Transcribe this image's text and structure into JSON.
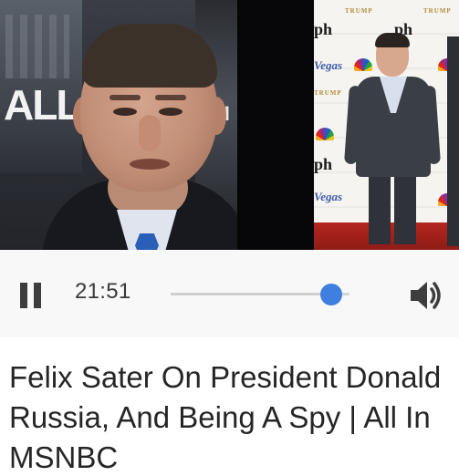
{
  "video": {
    "left_panel_overlay_text": "ALL",
    "left_panel_overlay_text_2": "H",
    "right_panel_logos": {
      "ph": "ph",
      "vegas": "Vegas",
      "trump": "TRUMP"
    }
  },
  "player": {
    "state_icon": "pause-icon",
    "time": "21:51",
    "progress": 0.9,
    "volume_icon": "volume-icon",
    "accent_color": "#3e7fe0"
  },
  "title": {
    "line1": "Felix Sater On President Donald",
    "line2": "Russia, And Being A Spy | All In",
    "line3": "MSNBC"
  }
}
